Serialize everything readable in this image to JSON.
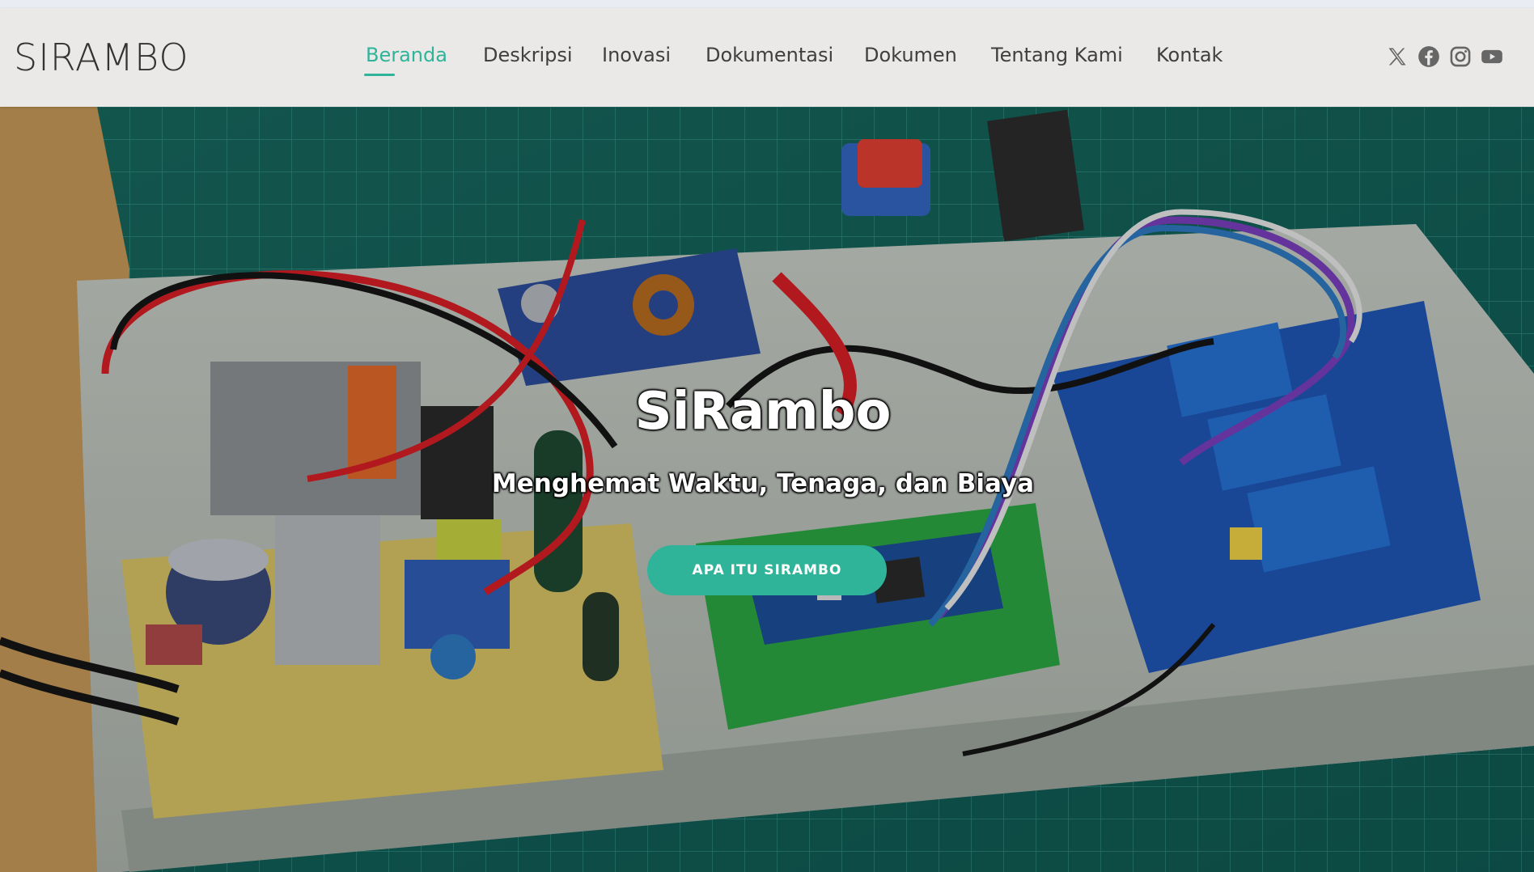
{
  "brand": {
    "logo_text": "SIRAMBO"
  },
  "nav": {
    "items": [
      {
        "label": "Beranda",
        "active": true
      },
      {
        "label": "Deskripsi",
        "active": false
      },
      {
        "label": "Inovasi",
        "active": false
      },
      {
        "label": "Dokumentasi",
        "active": false
      },
      {
        "label": "Dokumen",
        "active": false
      },
      {
        "label": "Tentang Kami",
        "active": false
      },
      {
        "label": "Kontak",
        "active": false
      }
    ]
  },
  "social": {
    "icons": [
      "x-twitter-icon",
      "facebook-icon",
      "instagram-icon",
      "youtube-icon"
    ]
  },
  "hero": {
    "title": "SiRambo",
    "subtitle": "Menghemat Waktu, Tenaga, dan Biaya",
    "cta_label": "APA ITU SIRAMBO",
    "background": "photo of electronic control board with relay module, arduino nano, and power supply on a green cutting mat"
  },
  "colors": {
    "accent": "#2fb49a",
    "header_bg": "#ebe9e7",
    "nav_text": "#3f3f3f"
  }
}
